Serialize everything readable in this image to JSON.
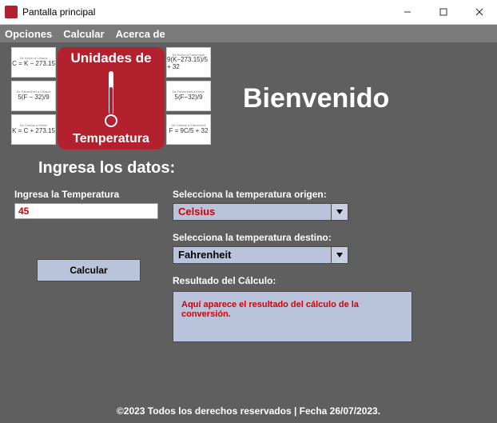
{
  "window": {
    "title": "Pantalla principal"
  },
  "menu": {
    "opciones": "Opciones",
    "calcular": "Calcular",
    "acerca": "Acerca de"
  },
  "logo": {
    "line1": "Unidades de",
    "line2": "Temperatura"
  },
  "formulas": {
    "left": [
      {
        "title": "De Kelvin a Celsius",
        "eq": "C = K − 273.15"
      },
      {
        "title": "De Fahrenheit a Celsius",
        "eq": "5(F − 32)/9"
      },
      {
        "title": "De Celsius a Kelvin",
        "eq": "K = C + 273.15"
      }
    ],
    "right": [
      {
        "title": "De Kelvin a Fahrenheit",
        "eq": "9(K−273.15)/5 + 32"
      },
      {
        "title": "De Fahrenheit a Kelvin",
        "eq": "5(F−32)/9"
      },
      {
        "title": "De Celsius a Fahrenheit",
        "eq": "F = 9C/5 + 32"
      }
    ]
  },
  "header": {
    "welcome": "Bienvenido",
    "prompt": "Ingresa los datos:"
  },
  "form": {
    "tempLabel": "Ingresa la Temperatura",
    "tempValue": "45",
    "calcButton": "Calcular",
    "originLabel": "Selecciona la temperatura origen:",
    "originValue": "Celsius",
    "destLabel": "Selecciona la temperatura destino:",
    "destValue": "Fahrenheit",
    "resultLabel": "Resultado del Cálculo:",
    "resultText": "Aquí aparece el resultado del cálculo de la conversión."
  },
  "footer": {
    "text": "©2023 Todos los derechos reservados | Fecha 26/07/2023."
  }
}
